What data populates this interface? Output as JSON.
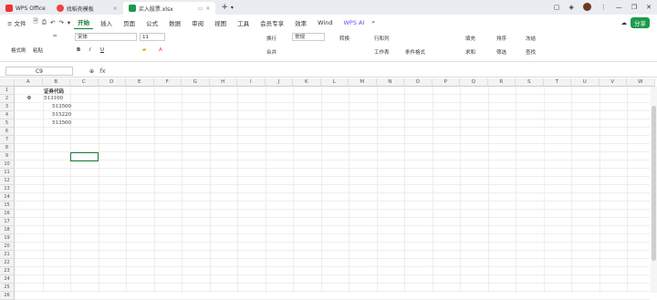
{
  "titlebar": {
    "tabs": [
      {
        "label": "WPS Office",
        "active": false
      },
      {
        "label": "找稻壳模板",
        "active": false
      },
      {
        "label": "买入股票.xlsx",
        "active": true
      }
    ]
  },
  "menubar": {
    "file_label": "≡ 文件",
    "items": [
      "开始",
      "插入",
      "页面",
      "公式",
      "数据",
      "审阅",
      "视图",
      "工具",
      "会员专享",
      "效率",
      "Wind"
    ],
    "active": "开始",
    "wps_ai": "WPS AI",
    "share": "分享"
  },
  "ribbon": {
    "format_painter": "格式刷",
    "paste": "粘贴",
    "font_name": "宋体",
    "font_size": "11",
    "wrap": "换行",
    "merge": "合并",
    "number_format": "常规",
    "convert": "转换",
    "rows_cols": "行和列",
    "worksheet": "工作表",
    "cond_format": "条件格式",
    "fill": "填充",
    "sort": "排序",
    "freeze": "冻结",
    "sum": "求和",
    "filter": "筛选",
    "find": "查找"
  },
  "formula": {
    "namebox": "C9",
    "fx": "fx",
    "content": ""
  },
  "sheet": {
    "columns": [
      "A",
      "B",
      "C",
      "D",
      "E",
      "F",
      "G",
      "H",
      "I",
      "J",
      "K",
      "L",
      "M",
      "N",
      "O",
      "P",
      "Q",
      "R",
      "S",
      "T",
      "U",
      "V",
      "W"
    ],
    "rows": [
      "1",
      "2",
      "3",
      "4",
      "5",
      "6",
      "7",
      "8",
      "9",
      "10",
      "11",
      "12",
      "13",
      "14",
      "15",
      "16",
      "17",
      "18",
      "19",
      "20",
      "21",
      "22",
      "23",
      "24",
      "25",
      "26"
    ],
    "cells": {
      "b1": "证券代码",
      "a2": "0",
      "b2": "513100",
      "b3": "513500",
      "b4": "515220",
      "b5": "513500"
    }
  }
}
